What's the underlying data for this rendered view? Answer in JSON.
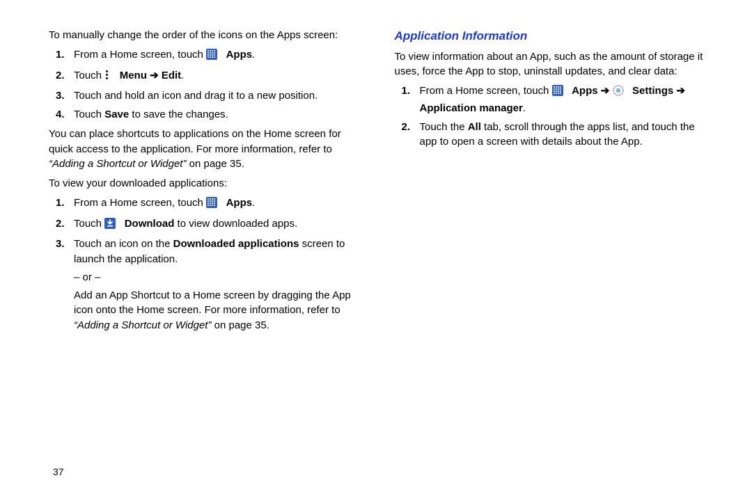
{
  "left": {
    "intro1": "To manually change the order of the icons on the Apps screen:",
    "steps1": {
      "s1_a": "From a Home screen, touch ",
      "s1_apps": "Apps",
      "s1_c": ".",
      "s2_a": "Touch ",
      "s2_menu": "Menu ",
      "s2_arrow": "➔ ",
      "s2_edit": "Edit",
      "s2_c": ".",
      "s3": "Touch and hold an icon and drag it to a new position.",
      "s4_a": "Touch ",
      "s4_save": "Save",
      "s4_b": " to save the changes."
    },
    "para2_a": "You can place shortcuts to applications on the Home screen for quick access to the application. For more information, refer to ",
    "para2_ref": "“Adding a Shortcut or Widget”",
    "para2_b": " on page 35.",
    "intro2": "To view your downloaded applications:",
    "steps2": {
      "s1_a": "From a Home screen, touch ",
      "s1_apps": "Apps",
      "s1_c": ".",
      "s2_a": "Touch ",
      "s2_dl": "Download",
      "s2_b": " to view downloaded apps.",
      "s3_a": "Touch an icon on the ",
      "s3_da": "Downloaded applications",
      "s3_b": " screen to launch the application.",
      "or": "– or –",
      "s3_c": "Add an App Shortcut to a Home screen by dragging the App icon onto the Home screen. For more information, refer to ",
      "s3_ref": "“Adding a Shortcut or Widget”",
      "s3_d": " on page 35."
    }
  },
  "right": {
    "heading": "Application Information",
    "intro": "To view information about an App, such as the amount of storage it uses, force the App to stop, uninstall updates, and clear data:",
    "steps": {
      "s1_a": "From a Home screen, touch ",
      "s1_apps": "Apps ",
      "s1_arrow1": "➔ ",
      "s1_settings": "Settings ",
      "s1_arrow2": "➔ ",
      "s1_appmgr": "Application manager",
      "s1_c": ".",
      "s2_a": "Touch the ",
      "s2_all": "All",
      "s2_b": " tab, scroll through the apps list, and touch the app to open a screen with details about the App."
    }
  },
  "page_number": "37"
}
